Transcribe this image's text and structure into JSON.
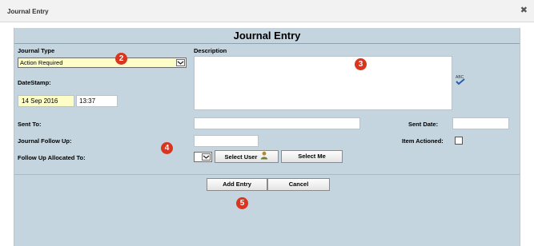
{
  "window": {
    "title": "Journal Entry",
    "close_glyph": "✖"
  },
  "panel": {
    "title": "Journal Entry"
  },
  "journal_type": {
    "label": "Journal Type",
    "value": "Action Required"
  },
  "description": {
    "label": "Description",
    "value": "",
    "spellcheck_text": "ABC"
  },
  "datestamp": {
    "label": "DateStamp:",
    "date": "14 Sep 2016",
    "time": "13:37"
  },
  "sent_to": {
    "label": "Sent To:",
    "value": ""
  },
  "sent_date": {
    "label": "Sent Date:",
    "value": ""
  },
  "follow_up": {
    "label": "Journal Follow Up:",
    "value": ""
  },
  "item_actioned": {
    "label": "Item Actioned:",
    "checked": false
  },
  "allocated_to": {
    "label": "Follow Up Allocated To:",
    "value": ""
  },
  "buttons": {
    "select_user": "Select User",
    "select_me": "Select Me",
    "add_entry": "Add Entry",
    "cancel": "Cancel"
  },
  "badges": [
    "2",
    "3",
    "4",
    "5"
  ],
  "colors": {
    "panel_bg": "#c5d5df",
    "highlight_field": "#fdfdc8",
    "badge": "#d9351f"
  },
  "icons": [
    "close-icon",
    "dropdown-arrow-icon",
    "spellcheck-icon",
    "user-icon"
  ]
}
